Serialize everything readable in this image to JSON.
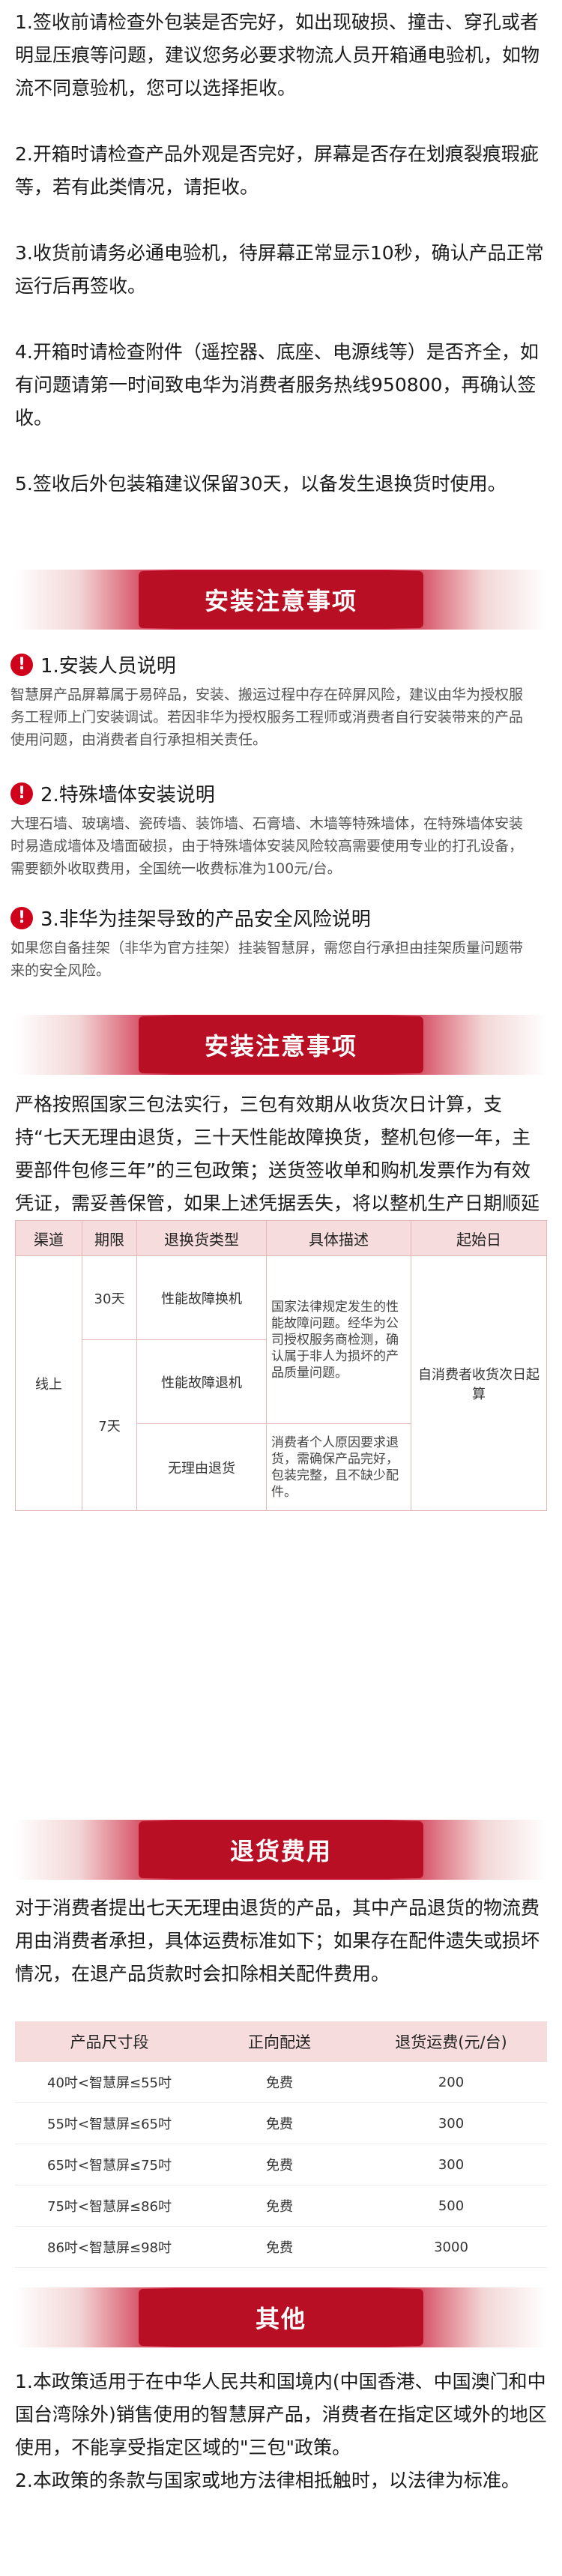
{
  "intro": [
    "1.签收前请检查外包装是否完好，如出现破损、撞击、穿孔或者明显压痕等问题，建议您务必要求物流人员开箱通电验机，如物流不同意验机，您可以选择拒收。",
    "2.开箱时请检查产品外观是否完好，屏幕是否存在划痕裂痕瑕疵等，若有此类情况，请拒收。",
    "3.收货前请务必通电验机，待屏幕正常显示10秒，确认产品正常运行后再签收。",
    "4.开箱时请检查附件（遥控器、底座、电源线等）是否齐全，如有问题请第一时间致电华为消费者服务热线950800，再确认签收。",
    "5.签收后外包装箱建议保留30天，以备发生退换货时使用。"
  ],
  "banner1": "安装注意事项",
  "notes": [
    {
      "icon": "!",
      "title": "1.安装人员说明",
      "body": "智慧屏产品屏幕属于易碎品，安装、搬运过程中存在碎屏风险，建议由华为授权服务工程师上门安装调试。若因非华为授权服务工程师或消费者自行安装带来的产品使用问题，由消费者自行承担相关责任。"
    },
    {
      "icon": "!",
      "title": "2.特殊墙体安装说明",
      "body": "大理石墙、玻璃墙、瓷砖墙、装饰墙、石膏墙、木墙等特殊墙体，在特殊墙体安装时易造成墙体及墙面破损，由于特殊墙体安装风险较高需要使用专业的打孔设备，需要额外收取费用，全国统一收费标准为100元/台。"
    },
    {
      "icon": "!",
      "title": "3.非华为挂架导致的产品安全风险说明",
      "body": "如果您自备挂架（非华为官方挂架）挂装智慧屏，需您自行承担由挂架质量问题带来的安全风险。"
    }
  ],
  "banner2": "安装注意事项",
  "policy_text": "严格按照国家三包法实行，三包有效期从收货次日计算，支持“七天无理由退货，三十天性能故障换货，整机包修一年，主要部件包修三年”的三包政策；送货签收单和购机发票作为有效凭证，需妥善保管，如果上述凭据丢失，将以整机生产日期顺延九十天作为三包有效期起始日。",
  "policy_table": {
    "headers": [
      "渠道",
      "期限",
      "退换货类型",
      "具体描述",
      "起始日"
    ],
    "channel": "线上",
    "rows": [
      {
        "period": "30天",
        "type": "性能故障换机"
      },
      {
        "period": "7天",
        "type": "性能故障退机"
      },
      {
        "period": "",
        "type": "无理由退货"
      }
    ],
    "desc_fault": "国家法律规定发生的性能故障问题。经华为公司授权服务商检测，确认属于非人为损坏的产品质量问题。",
    "desc_noreason": "消费者个人原因要求退货，需确保产品完好，包装完整，且不缺少配件。",
    "start": "自消费者收货次日起算"
  },
  "banner3": "退货费用",
  "fee_text": "对于消费者提出七天无理由退货的产品，其中产品退货的物流费用由消费者承担，具体运费标准如下；如果存在配件遗失或损坏情况，在退产品货款时会扣除相关配件费用。",
  "fee_table": {
    "headers": [
      "产品尺寸段",
      "正向配送",
      "退货运费(元/台)"
    ],
    "rows": [
      [
        "40吋<智慧屏≤55吋",
        "免费",
        "200"
      ],
      [
        "55吋<智慧屏≤65吋",
        "免费",
        "300"
      ],
      [
        "65吋<智慧屏≤75吋",
        "免费",
        "300"
      ],
      [
        "75吋<智慧屏≤86吋",
        "免费",
        "500"
      ],
      [
        "86吋<智慧屏≤98吋",
        "免费",
        "3000"
      ]
    ]
  },
  "banner4": "其他",
  "other": [
    "1.本政策适用于在中华人民共和国境内(中国香港、中国澳门和中国台湾除外)销售使用的智慧屏产品，消费者在指定区域外的地区使用，不能享受指定区域的\"三包\"政策。",
    "2.本政策的条款与国家或地方法律相抵触时，以法律为标准。"
  ],
  "colors": {
    "accent": "#c8102e",
    "table_head": "#f6dcdc"
  }
}
